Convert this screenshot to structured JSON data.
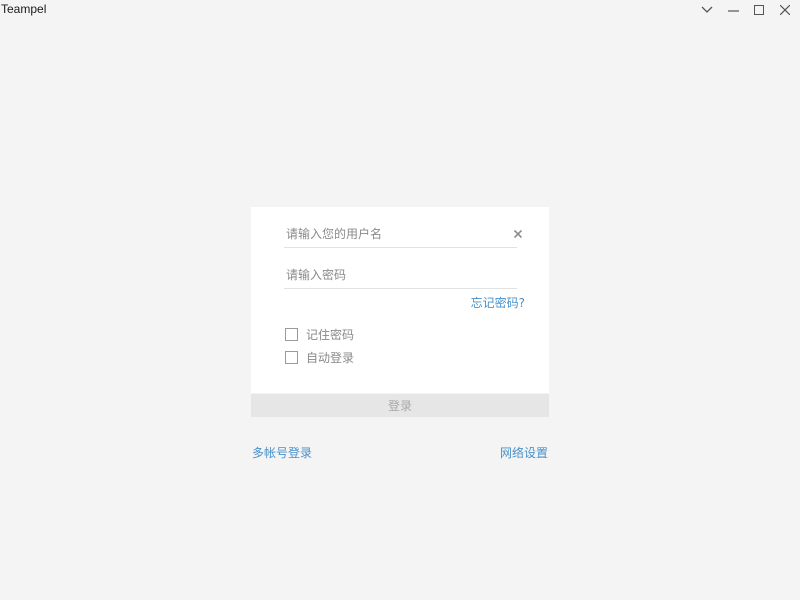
{
  "window": {
    "title": "Teampel",
    "controls": [
      "chevron-down-icon",
      "minimize-icon",
      "maximize-icon",
      "close-icon"
    ]
  },
  "login": {
    "username_placeholder": "请输入您的用户名",
    "password_placeholder": "请输入密码",
    "username_value": "",
    "password_value": "",
    "forgot_label": "忘记密码?",
    "remember_label": "记住密码",
    "remember_checked": false,
    "autologin_label": "自动登录",
    "autologin_checked": false,
    "submit_label": "登录"
  },
  "footer": {
    "multi_account_label": "多帐号登录",
    "network_settings_label": "网络设置"
  },
  "colors": {
    "background": "#f4f4f4",
    "card": "#ffffff",
    "link": "#4a90c8",
    "button_disabled_bg": "#e6e6e6",
    "button_disabled_text": "#a8a8a8"
  }
}
